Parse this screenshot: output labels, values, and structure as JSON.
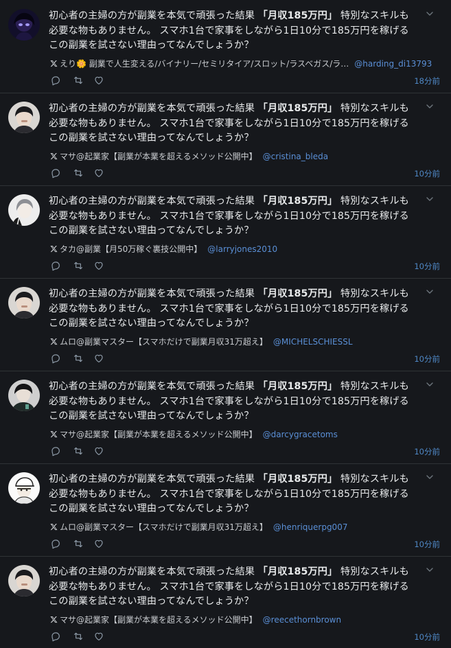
{
  "colors": {
    "background": "#16181c",
    "text": "#e7e9ea",
    "link": "#5a8fd6",
    "muted": "#8b98a5",
    "divider": "#2f3336"
  },
  "tweets": [
    {
      "line1_pre": "初心者の主婦の方が副業を本気で頑張った結果 ",
      "line1_bold": "「月収185万円」",
      "line1_post": " 特別なスキルも",
      "line2": "必要な物もありません。 スマホ1台で家事をしながら1日10分で185万円を稼げる",
      "line3": "この副業を試さない理由ってなんでしょうか？",
      "author": "えり🌼 副業で人生変える/バイナリー/セミリタイア/スロット/ラスベガス/ラ…",
      "handle": "@harding_di13793",
      "time": "18分前",
      "avatar_icon": "avatar-dark-hair-purple"
    },
    {
      "line1_pre": "初心者の主婦の方が副業を本気で頑張った結果 ",
      "line1_bold": "「月収185万円」",
      "line1_post": " 特別なスキルも",
      "line2": "必要な物もありません。 スマホ1台で家事をしながら1日10分で185万円を稼げる",
      "line3": "この副業を試さない理由ってなんでしょうか？",
      "author": "マサ@起業家【副業が本業を超えるメソッド公開中】",
      "handle": "@cristina_bleda",
      "time": "10分前",
      "avatar_icon": "avatar-man-dark-hair"
    },
    {
      "line1_pre": "初心者の主婦の方が副業を本気で頑張った結果 ",
      "line1_bold": "「月収185万円」",
      "line1_post": " 特別なスキルも",
      "line2": "必要な物もありません。 スマホ1台で家事をしながら1日10分で185万円を稼げる",
      "line3": "この副業を試さない理由ってなんでしょうか？",
      "author": "タカ@副業【月50万稼ぐ裏技公開中】",
      "handle": "@larryjones2010",
      "time": "10分前",
      "avatar_icon": "avatar-grey-hair"
    },
    {
      "line1_pre": "初心者の主婦の方が副業を本気で頑張った結果 ",
      "line1_bold": "「月収185万円」",
      "line1_post": " 特別なスキルも",
      "line2": "必要な物もありません。 スマホ1台で家事をしながら1日10分で185万円を稼げる",
      "line3": "この副業を試さない理由ってなんでしょうか？",
      "author": "ムロ@副業マスター【スマホだけで副業月収31万超え】",
      "handle": "@MICHELSCHIESSL",
      "time": "10分前",
      "avatar_icon": "avatar-man-dark-hair"
    },
    {
      "line1_pre": "初心者の主婦の方が副業を本気で頑張った結果 ",
      "line1_bold": "「月収185万円」",
      "line1_post": " 特別なスキルも",
      "line2": "必要な物もありません。 スマホ1台で家事をしながら1日10分で185万円を稼げる",
      "line3": "この副業を試さない理由ってなんでしょうか？",
      "author": "マサ@起業家【副業が本業を超えるメソッド公開中】",
      "handle": "@darcygracetoms",
      "time": "10分前",
      "avatar_icon": "avatar-dark-coat"
    },
    {
      "line1_pre": "初心者の主婦の方が副業を本気で頑張った結果 ",
      "line1_bold": "「月収185万円」",
      "line1_post": " 特別なスキルも",
      "line2": "必要な物もありません。 スマホ1台で家事をしながら1日10分で185万円を稼げる",
      "line3": "この副業を試さない理由ってなんでしょうか？",
      "author": "ムロ@副業マスター【スマホだけで副業月収31万超え】",
      "handle": "@henriquerpg007",
      "time": "10分前",
      "avatar_icon": "avatar-white-cap"
    },
    {
      "line1_pre": "初心者の主婦の方が副業を本気で頑張った結果 ",
      "line1_bold": "「月収185万円」",
      "line1_post": " 特別なスキルも",
      "line2": "必要な物もありません。 スマホ1台で家事をしながら1日10分で185万円を稼げる",
      "line3": "この副業を試さない理由ってなんでしょうか？",
      "author": "マサ@起業家【副業が本業を超えるメソッド公開中】",
      "handle": "@reecethornbrown",
      "time": "10分前",
      "avatar_icon": "avatar-man-dark-hair"
    }
  ]
}
